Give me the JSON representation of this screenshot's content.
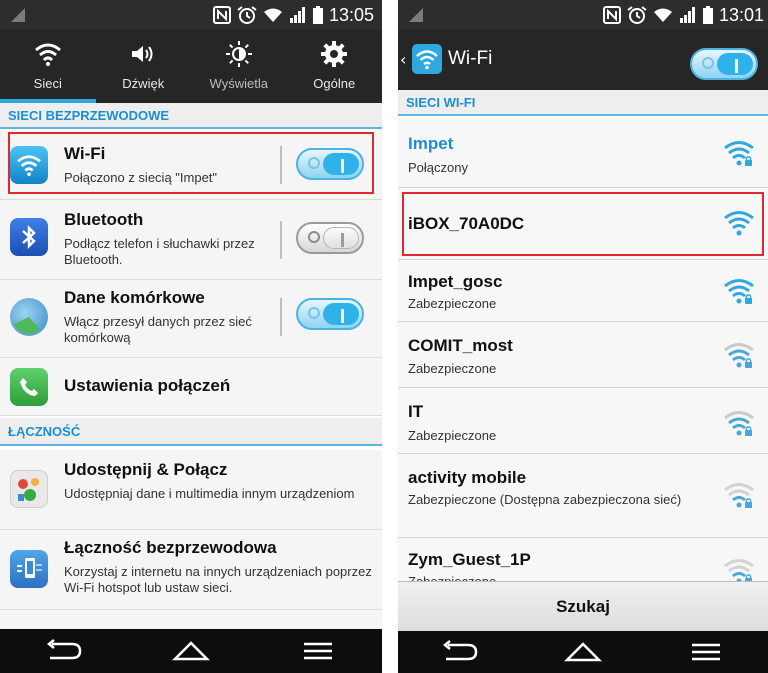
{
  "left_panel": {
    "status_bar": {
      "time": "13:05"
    },
    "tabs": [
      {
        "label": "Sieci",
        "icon": "wifi-icon"
      },
      {
        "label": "Dźwięk",
        "icon": "speaker-icon"
      },
      {
        "label": "Wyświetla",
        "icon": "brightness-icon"
      },
      {
        "label": "Ogólne",
        "icon": "gear-icon"
      }
    ],
    "section_wireless": "SIECI BEZPRZEWODOWE",
    "wifi": {
      "title": "Wi-Fi",
      "subtitle": "Połączono z siecią \"Impet\"",
      "toggle": "on"
    },
    "bluetooth": {
      "title": "Bluetooth",
      "subtitle": "Podłącz telefon i słuchawki przez Bluetooth.",
      "toggle": "off"
    },
    "mobile_data": {
      "title": "Dane komórkowe",
      "subtitle": "Włącz przesył danych przez sieć komórkową",
      "toggle": "on"
    },
    "call_settings": {
      "title": "Ustawienia połączeń"
    },
    "section_connectivity": "ŁĄCZNOŚĆ",
    "share_connect": {
      "title": "Udostępnij & Połącz",
      "subtitle": "Udostępniaj dane i multimedia innym urządzeniom"
    },
    "wireless_connectivity": {
      "title": "Łączność bezprzewodowa",
      "subtitle": "Korzystaj z internetu na innych urządzeniach poprzez Wi-Fi hotspot lub ustaw sieci."
    }
  },
  "right_panel": {
    "status_bar": {
      "time": "13:01"
    },
    "header_title": "Wi-Fi",
    "section_networks": "SIECI WI-FI",
    "networks": [
      {
        "name": "Impet",
        "status": "Połączony",
        "connected": true,
        "secured": true
      },
      {
        "name": "iBOX_70A0DC",
        "status": "",
        "connected": false,
        "secured": false
      },
      {
        "name": "Impet_gosc",
        "status": "Zabezpieczone",
        "connected": false,
        "secured": true
      },
      {
        "name": "COMIT_most",
        "status": "Zabezpieczone",
        "connected": false,
        "secured": true
      },
      {
        "name": "IT",
        "status": "Zabezpieczone",
        "connected": false,
        "secured": true
      },
      {
        "name": "activity mobile",
        "status": "Zabezpieczone (Dostępna zabezpieczona sieć)",
        "connected": false,
        "secured": true
      },
      {
        "name": "Zym_Guest_1P",
        "status": "Zabezpieczone",
        "connected": false,
        "secured": true
      }
    ],
    "search_button": "Szukaj"
  },
  "colors": {
    "accent": "#2fa8e0",
    "section_text": "#1b8fd2",
    "highlight": "#e0282e",
    "bars_dark": "#262626"
  }
}
